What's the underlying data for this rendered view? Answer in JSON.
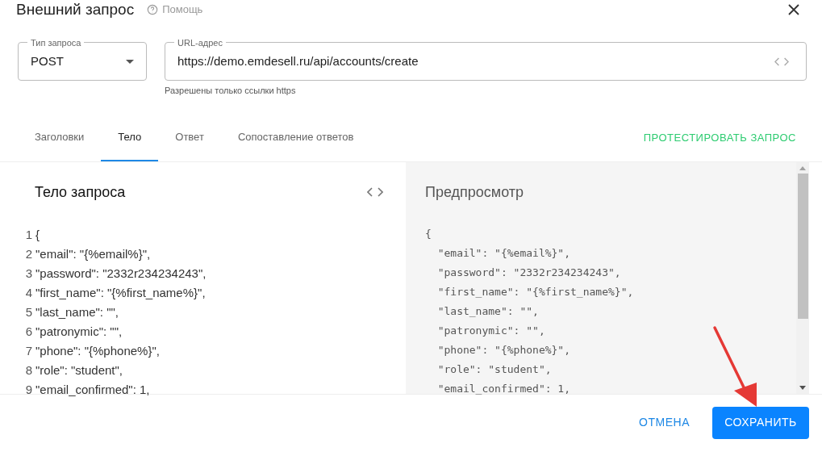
{
  "dialog": {
    "title": "Внешний запрос",
    "help": "Помощь"
  },
  "request_type": {
    "label": "Тип запроса",
    "value": "POST"
  },
  "url": {
    "label": "URL-адрес",
    "value": "https://demo.emdesell.ru/api/accounts/create",
    "helper": "Разрешены только ссылки https"
  },
  "tabs": [
    {
      "label": "Заголовки",
      "selected": false
    },
    {
      "label": "Тело",
      "selected": true
    },
    {
      "label": "Ответ",
      "selected": false
    },
    {
      "label": "Сопоставление ответов",
      "selected": false
    }
  ],
  "test_button": "ПРОТЕСТИРОВАТЬ ЗАПРОС",
  "body_editor": {
    "title": "Тело запроса",
    "lines": [
      {
        "number": "1",
        "text": "{"
      },
      {
        "number": "2",
        "text": "\"email\": \"{%email%}\","
      },
      {
        "number": "3",
        "text": "\"password\": \"2332r234234243\","
      },
      {
        "number": "4",
        "text": "\"first_name\": \"{%first_name%}\","
      },
      {
        "number": "5",
        "text": "\"last_name\": \"\","
      },
      {
        "number": "6",
        "text": "\"patronymic\": \"\","
      },
      {
        "number": "7",
        "text": "\"phone\": \"{%phone%}\","
      },
      {
        "number": "8",
        "text": "\"role\": \"student\","
      },
      {
        "number": "9",
        "text": "\"email_confirmed\": 1,"
      }
    ]
  },
  "preview": {
    "title": "Предпросмотр",
    "lines": [
      "{",
      "  \"email\": \"{%email%}\",",
      "  \"password\": \"2332r234234243\",",
      "  \"first_name\": \"{%first_name%}\",",
      "  \"last_name\": \"\",",
      "  \"patronymic\": \"\",",
      "  \"phone\": \"{%phone%}\",",
      "  \"role\": \"student\",",
      "  \"email_confirmed\": 1,"
    ]
  },
  "footer": {
    "cancel": "ОТМЕНА",
    "save": "СОХРАНИТЬ"
  }
}
